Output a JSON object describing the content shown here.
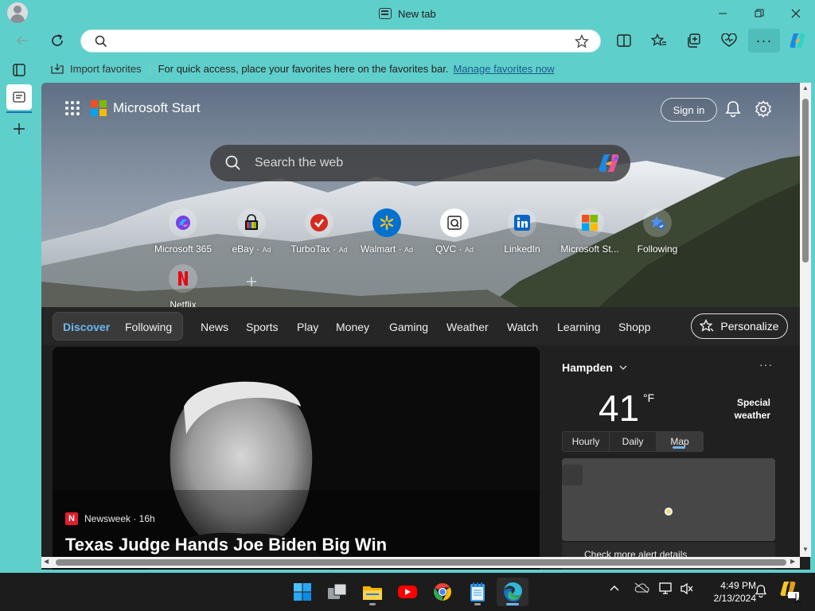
{
  "window": {
    "tab_title": "New tab"
  },
  "toolbar": {
    "address_value": "",
    "address_placeholder": ""
  },
  "favorites_bar": {
    "import_label": "Import favorites",
    "message": "For quick access, place your favorites here on the favorites bar.",
    "manage_link": "Manage favorites now"
  },
  "ms_start": {
    "brand": "Microsoft Start",
    "sign_in": "Sign in",
    "search_placeholder": "Search the web"
  },
  "quick_links": [
    {
      "label": "Microsoft 365",
      "ad": "",
      "icon": "microsoft-365-icon"
    },
    {
      "label": "eBay",
      "ad": "Ad",
      "icon": "ebay-icon"
    },
    {
      "label": "TurboTax",
      "ad": "Ad",
      "icon": "turbotax-icon"
    },
    {
      "label": "Walmart",
      "ad": "Ad",
      "icon": "walmart-icon"
    },
    {
      "label": "QVC",
      "ad": "Ad",
      "icon": "qvc-icon"
    },
    {
      "label": "LinkedIn",
      "ad": "",
      "icon": "linkedin-icon"
    },
    {
      "label": "Microsoft St...",
      "ad": "",
      "icon": "microsoft-store-icon"
    },
    {
      "label": "Following",
      "ad": "",
      "icon": "following-icon"
    },
    {
      "label": "Netflix",
      "ad": "",
      "icon": "netflix-icon"
    }
  ],
  "nav": {
    "items": [
      "Discover",
      "Following",
      "News",
      "Sports",
      "Play",
      "Money",
      "Gaming",
      "Weather",
      "Watch",
      "Learning",
      "Shopp"
    ],
    "selected": "Discover",
    "personalize": "Personalize"
  },
  "news": {
    "source_logo": "N",
    "source": "Newsweek · 16h",
    "headline": "Texas Judge Hands Joe Biden Big Win"
  },
  "weather": {
    "location": "Hampden",
    "temp": "41",
    "unit": "°F",
    "special": "Special weather",
    "tabs": [
      "Hourly",
      "Daily",
      "Map"
    ],
    "selected_tab": "Map",
    "alert": "Check more alert details"
  },
  "taskbar": {
    "apps": [
      "start-icon",
      "task-view-icon",
      "file-explorer-icon",
      "youtube-icon",
      "chrome-icon",
      "notepad-icon",
      "edge-icon"
    ],
    "time": "4:49 PM",
    "date": "2/13/2024"
  },
  "colors": {
    "frame": "#5fcfcb",
    "accent": "#6cb8f0",
    "content_bg": "#202020",
    "taskbar": "#1c1c1c"
  }
}
